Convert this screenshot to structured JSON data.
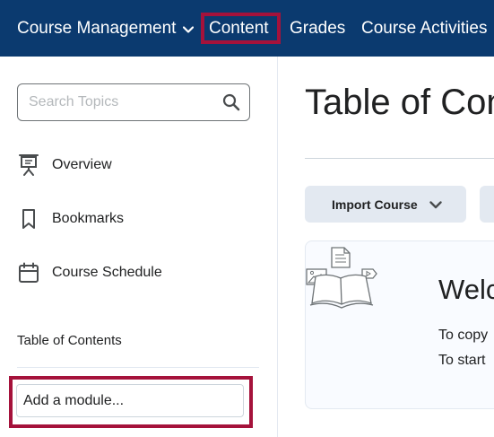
{
  "nav": {
    "course_management": "Course Management",
    "content": "Content",
    "grades": "Grades",
    "course_activities": "Course Activities"
  },
  "sidebar": {
    "search_placeholder": "Search Topics",
    "items": [
      {
        "label": "Overview",
        "icon": "presentation-icon"
      },
      {
        "label": "Bookmarks",
        "icon": "bookmark-icon"
      },
      {
        "label": "Course Schedule",
        "icon": "calendar-icon"
      }
    ],
    "toc_label": "Table of Contents",
    "add_module_value": "Add a module..."
  },
  "main": {
    "title": "Table of Con",
    "import_button": "Import Course",
    "welcome": {
      "title": "Welc",
      "line1": "To copy",
      "line2": "To start"
    }
  },
  "colors": {
    "nav_bg": "#0b3a6f",
    "highlight": "#a5123b",
    "button_bg": "#e3e9f1"
  }
}
